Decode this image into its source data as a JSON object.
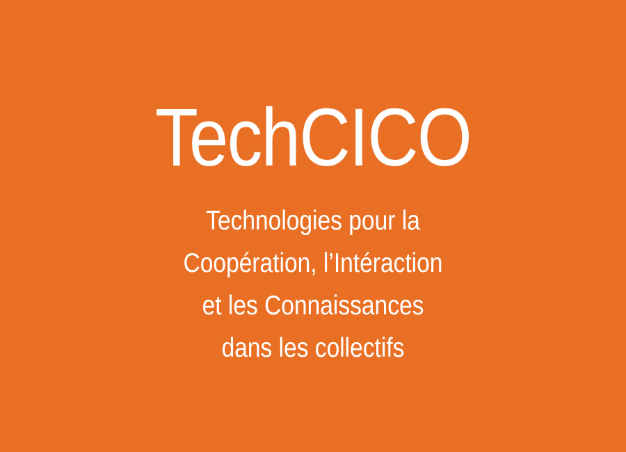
{
  "background_color": "#E96F24",
  "text_color": "#FFFFFF",
  "title": "TechCICO",
  "subtitle_lines": [
    "Technologies pour la",
    "Coopération, l’Intéraction",
    "et les Connaissances",
    "dans les collectifs"
  ]
}
